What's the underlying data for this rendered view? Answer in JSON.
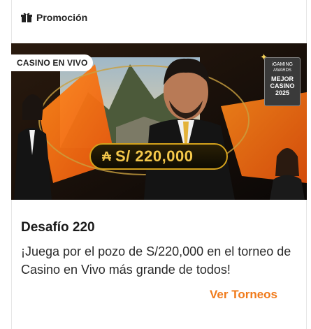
{
  "header": {
    "label": "Promoción",
    "icon": "gift-icon"
  },
  "banner": {
    "tag": "CASINO EN VIVO",
    "prize_symbol": "₳",
    "prize_amount": "S/ 220,000",
    "award_line1": "iGAMING",
    "award_line2": "AWARDS",
    "award_line3": "MEJOR",
    "award_line4": "CASINO",
    "award_line5": "2025"
  },
  "promo": {
    "title": "Desafío 220",
    "description": "¡Juega por el pozo de S/220,000 en el torneo de Casino en Vivo más grande de todos!",
    "cta": "Ver Torneos"
  },
  "colors": {
    "accent": "#f07a1a",
    "gold": "#d4a21c"
  }
}
